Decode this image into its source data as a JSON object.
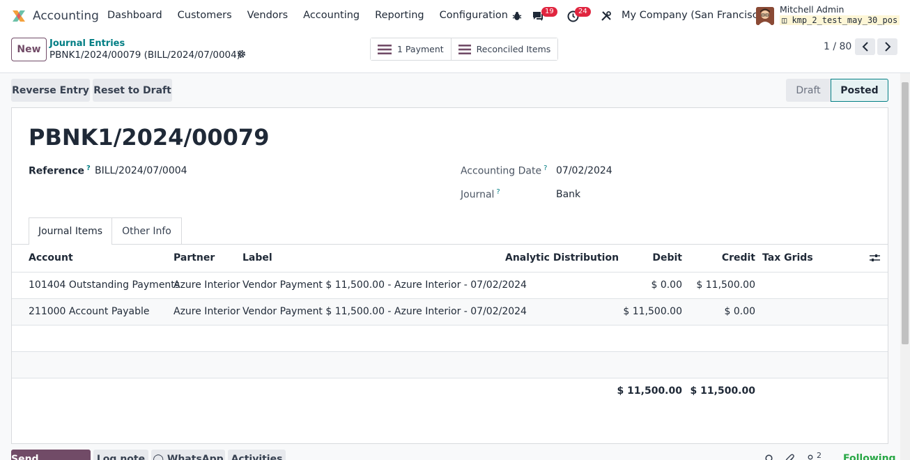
{
  "navbar": {
    "app_name": "Accounting",
    "menu": [
      "Dashboard",
      "Customers",
      "Vendors",
      "Accounting",
      "Reporting",
      "Configuration"
    ],
    "messages_count": "19",
    "activities_count": "24",
    "company": "My Company (San Francisco)",
    "user_name": "Mitchell Admin",
    "db_name": "kmp_2_test_may_30_pos"
  },
  "control": {
    "new_label": "New",
    "breadcrumb_parent": "Journal Entries",
    "breadcrumb_current": "PBNK1/2024/00079 (BILL/2024/07/0004)",
    "smart_buttons": [
      "1 Payment",
      "Reconciled Items"
    ],
    "pager": "1 / 80"
  },
  "actions": {
    "reverse": "Reverse Entry",
    "reset": "Reset to Draft"
  },
  "status": {
    "draft": "Draft",
    "posted": "Posted"
  },
  "form": {
    "title": "PBNK1/2024/00079",
    "reference_label": "Reference",
    "reference_value": "BILL/2024/07/0004",
    "date_label": "Accounting Date",
    "date_value": "07/02/2024",
    "journal_label": "Journal",
    "journal_value": "Bank",
    "help_mark": "?"
  },
  "tabs": [
    "Journal Items",
    "Other Info"
  ],
  "table": {
    "headers": [
      "Account",
      "Partner",
      "Label",
      "Analytic Distribution",
      "Debit",
      "Credit",
      "Tax Grids"
    ],
    "rows": [
      {
        "account": "101404 Outstanding Payments",
        "partner": "Azure Interior",
        "label": "Vendor Payment $ 11,500.00 - Azure Interior - 07/02/2024",
        "debit": "$ 0.00",
        "credit": "$ 11,500.00"
      },
      {
        "account": "211000 Account Payable",
        "partner": "Azure Interior",
        "label": "Vendor Payment $ 11,500.00 - Azure Interior - 07/02/2024",
        "debit": "$ 11,500.00",
        "credit": "$ 0.00"
      }
    ],
    "total_debit": "$ 11,500.00",
    "total_credit": "$ 11,500.00"
  },
  "chatter": {
    "buttons": [
      "Send message",
      "Log note",
      "WhatsApp",
      "Activities"
    ],
    "followers_count": "2",
    "following": "Following"
  }
}
